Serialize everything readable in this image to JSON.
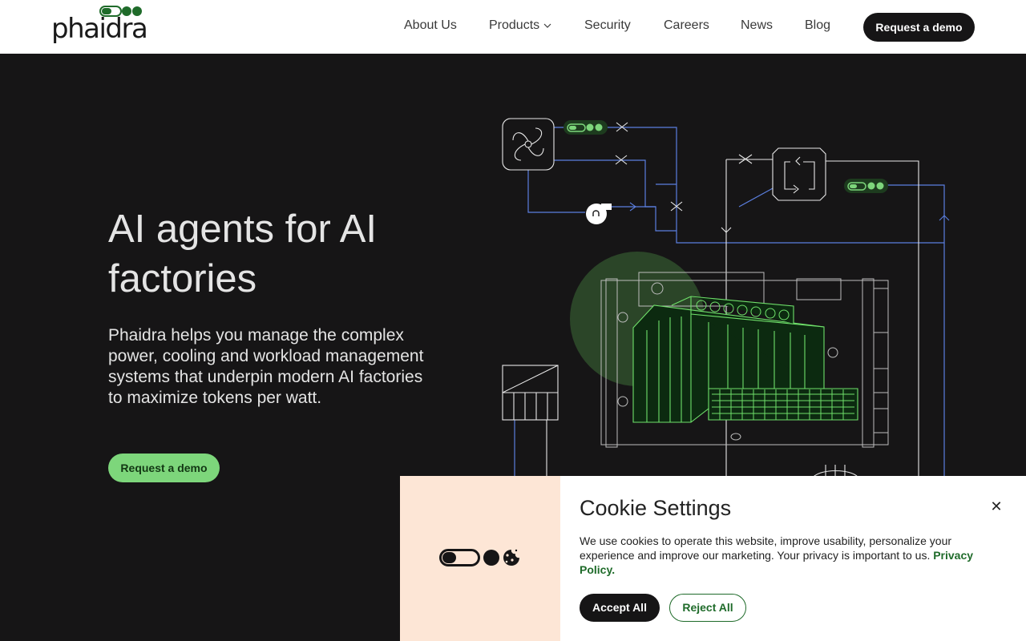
{
  "header": {
    "logo_text": "phaidra",
    "nav": [
      {
        "label": "About Us"
      },
      {
        "label": "Products"
      },
      {
        "label": "Security"
      },
      {
        "label": "Careers"
      },
      {
        "label": "News"
      },
      {
        "label": "Blog"
      }
    ],
    "cta_label": "Request a demo"
  },
  "hero": {
    "title": "AI agents for AI factories",
    "subtitle": "Phaidra helps you manage the complex power, cooling and workload management systems that underpin modern AI factories to maximize tokens per watt.",
    "cta_label": "Request a demo"
  },
  "cookie": {
    "title": "Cookie Settings",
    "close_label": "✕",
    "body": "We use cookies to operate this website, improve usability, personalize your experience and improve our marketing. Your privacy is important to us. ",
    "privacy_link": "Privacy Policy.",
    "accept_label": "Accept All",
    "reject_label": "Reject All"
  },
  "colors": {
    "brand_dark": "#161516",
    "brand_green": "#7dd67b",
    "accent_blue": "#5b7fe0",
    "cookie_bg": "#fde6d6"
  },
  "icons": {
    "logo_mark": "toggle-dots-icon",
    "nav_products": "chevron-down-icon",
    "cookie_art": "toggle-cookie-icon"
  }
}
